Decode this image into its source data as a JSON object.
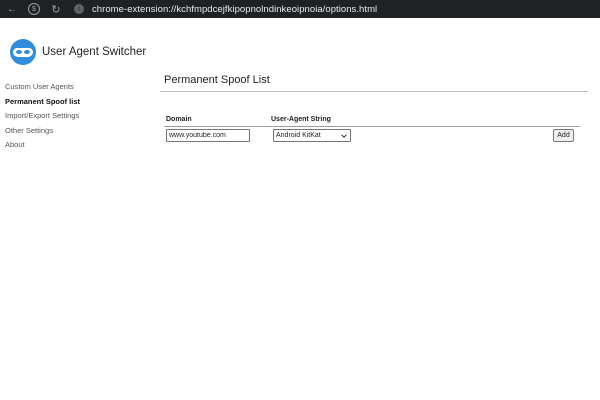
{
  "browser": {
    "url": "chrome-extension://kchfmpdcejfkipopnolndinkeoipnoia/options.html",
    "back_icon": "arrow-left-icon",
    "forward_icon": "dollar-circle-icon",
    "reload_icon": "reload-icon",
    "site_icon": "extension-info-icon"
  },
  "header": {
    "title": "User Agent Switcher",
    "logo_icon": "masked-face-logo",
    "logo_color": "#2f8ddb"
  },
  "sidebar": {
    "items": [
      {
        "label": "Custom User Agents",
        "active": false
      },
      {
        "label": "Permanent Spoof list",
        "active": true
      },
      {
        "label": "Import/Export Settings",
        "active": false
      },
      {
        "label": "Other Settings",
        "active": false
      },
      {
        "label": "About",
        "active": false
      }
    ]
  },
  "main": {
    "title": "Permanent Spoof List",
    "table": {
      "columns": [
        "Domain",
        "User-Agent String"
      ],
      "new_row": {
        "domain_value": "www.youtube.com",
        "ua_selected": "Android KitKat",
        "add_label": "Add"
      }
    }
  }
}
